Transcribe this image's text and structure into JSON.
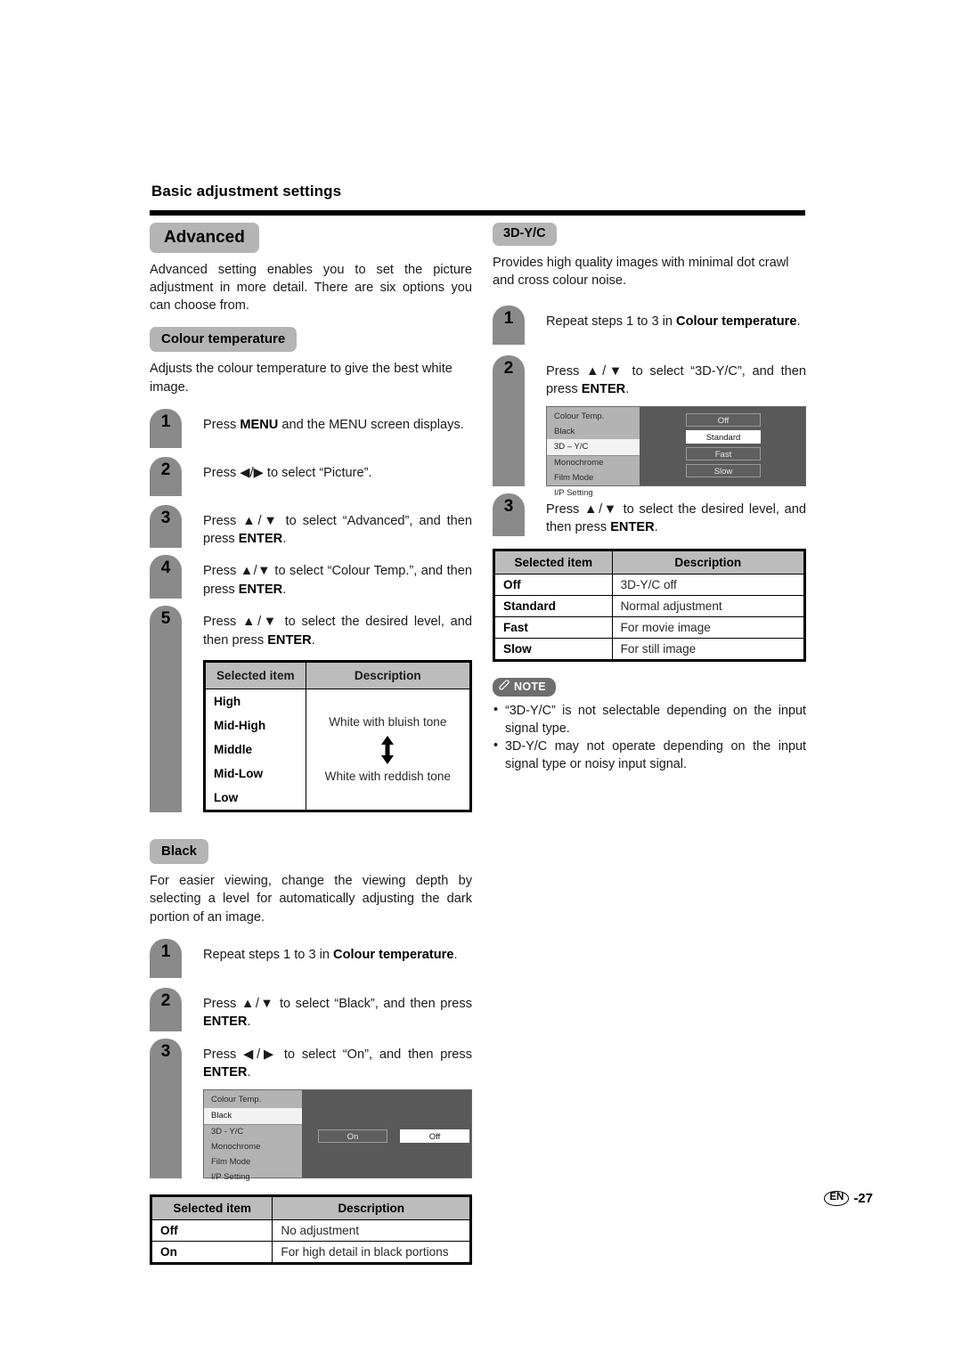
{
  "header": {
    "title": "Basic adjustment settings"
  },
  "left": {
    "advanced": {
      "heading": "Advanced",
      "intro": "Advanced setting enables you to set the picture adjustment in more detail.  There are six options you can choose from."
    },
    "colour_temperature": {
      "heading": "Colour temperature",
      "intro": "Adjusts the colour temperature to give the best white image.",
      "steps": [
        {
          "num": "1",
          "text_html": "Press <b>MENU</b> and the MENU screen displays."
        },
        {
          "num": "2",
          "text_html": "Press ◀/▶ to select “Picture”."
        },
        {
          "num": "3",
          "text_html": "Press ▲/▼ to select “Advanced”, and then press <b>ENTER</b>."
        },
        {
          "num": "4",
          "text_html": "Press ▲/▼ to select “Colour Temp.”, and then press <b>ENTER</b>."
        },
        {
          "num": "5",
          "text_html": "Press ▲/▼ to select the desired level, and then press <b>ENTER</b>."
        }
      ],
      "table": {
        "headers": [
          "Selected item",
          "Description"
        ],
        "items": [
          "High",
          "Mid-High",
          "Middle",
          "Mid-Low",
          "Low"
        ],
        "desc_top": "White with bluish tone",
        "desc_bottom": "White with reddish tone"
      }
    },
    "black": {
      "heading": "Black",
      "intro": "For easier viewing, change the viewing depth by selecting a level for automatically adjusting the dark portion of an image.",
      "steps": [
        {
          "num": "1",
          "text_html": "Repeat steps 1 to 3 in <b>Colour temperature</b>."
        },
        {
          "num": "2",
          "text_html": "Press ▲/▼ to select “Black”, and then press <b>ENTER</b>."
        },
        {
          "num": "3",
          "text_html": "Press ◀/▶ to select “On”, and then press <b>ENTER</b>."
        }
      ],
      "osd": {
        "menu_items": [
          "Colour Temp.",
          "Black",
          "3D - Y/C",
          "Monochrome",
          "Film Mode",
          "I/P Setting"
        ],
        "selected_menu_item": "Black",
        "buttons": [
          "On",
          "Off"
        ],
        "active_button": "Off"
      },
      "table": {
        "headers": [
          "Selected item",
          "Description"
        ],
        "rows": [
          {
            "item": "Off",
            "desc": "No adjustment"
          },
          {
            "item": "On",
            "desc": "For high detail in black portions"
          }
        ]
      }
    }
  },
  "right": {
    "threed_yc": {
      "heading": "3D-Y/C",
      "intro": "Provides high quality images with minimal dot crawl and cross colour noise.",
      "steps": [
        {
          "num": "1",
          "text_html": "Repeat steps 1 to 3 in <b>Colour temperature</b>."
        },
        {
          "num": "2",
          "text_html": "Press ▲/▼ to select “3D-Y/C”, and then press <b>ENTER</b>."
        },
        {
          "num": "3",
          "text_html": "Press ▲/▼ to select the desired level, and then press <b>ENTER</b>."
        }
      ],
      "osd": {
        "menu_items": [
          "Colour Temp.",
          "Black",
          "3D – Y/C",
          "Monochrome",
          "Film Mode",
          "I/P Setting"
        ],
        "selected_menu_item": "3D – Y/C",
        "buttons": [
          "Off",
          "Standard",
          "Fast",
          "Slow"
        ],
        "active_button": "Standard"
      },
      "table": {
        "headers": [
          "Selected item",
          "Description"
        ],
        "rows": [
          {
            "item": "Off",
            "desc": "3D-Y/C off"
          },
          {
            "item": "Standard",
            "desc": "Normal adjustment"
          },
          {
            "item": "Fast",
            "desc": "For movie image"
          },
          {
            "item": "Slow",
            "desc": "For still image"
          }
        ]
      }
    },
    "note": {
      "label": "NOTE",
      "items": [
        "“3D-Y/C” is not selectable depending on the input signal type.",
        "3D-Y/C may not operate depending on the input signal type or noisy input signal."
      ]
    }
  },
  "footer": {
    "lang": "EN",
    "page": "-27"
  },
  "colors": {
    "pill_gray": "#b4b4b4",
    "step_gray": "#8a8a8a",
    "table_header_gray": "#bcbcbc",
    "osd_menu_gray": "#b3b3b3",
    "osd_panel_gray": "#595959",
    "note_badge_gray": "#6e6e6e"
  }
}
